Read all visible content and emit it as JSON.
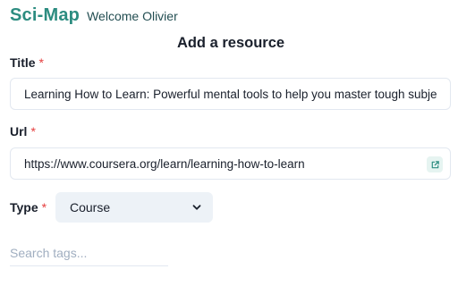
{
  "header": {
    "brand": "Sci-Map",
    "welcome": "Welcome Olivier"
  },
  "form": {
    "title": "Add a resource",
    "required_marker": "*",
    "title_field": {
      "label": "Title",
      "value": "Learning How to Learn: Powerful mental tools to help you master tough subjects"
    },
    "url_field": {
      "label": "Url",
      "value": "https://www.coursera.org/learn/learning-how-to-learn",
      "open_icon": "external-link-icon"
    },
    "type_field": {
      "label": "Type",
      "selected": "Course",
      "icon": "chevron-down-icon"
    },
    "tags_field": {
      "placeholder": "Search tags..."
    }
  },
  "colors": {
    "brand": "#2c8c80",
    "required": "#e53e3e",
    "select_bg": "#edf2f7"
  }
}
